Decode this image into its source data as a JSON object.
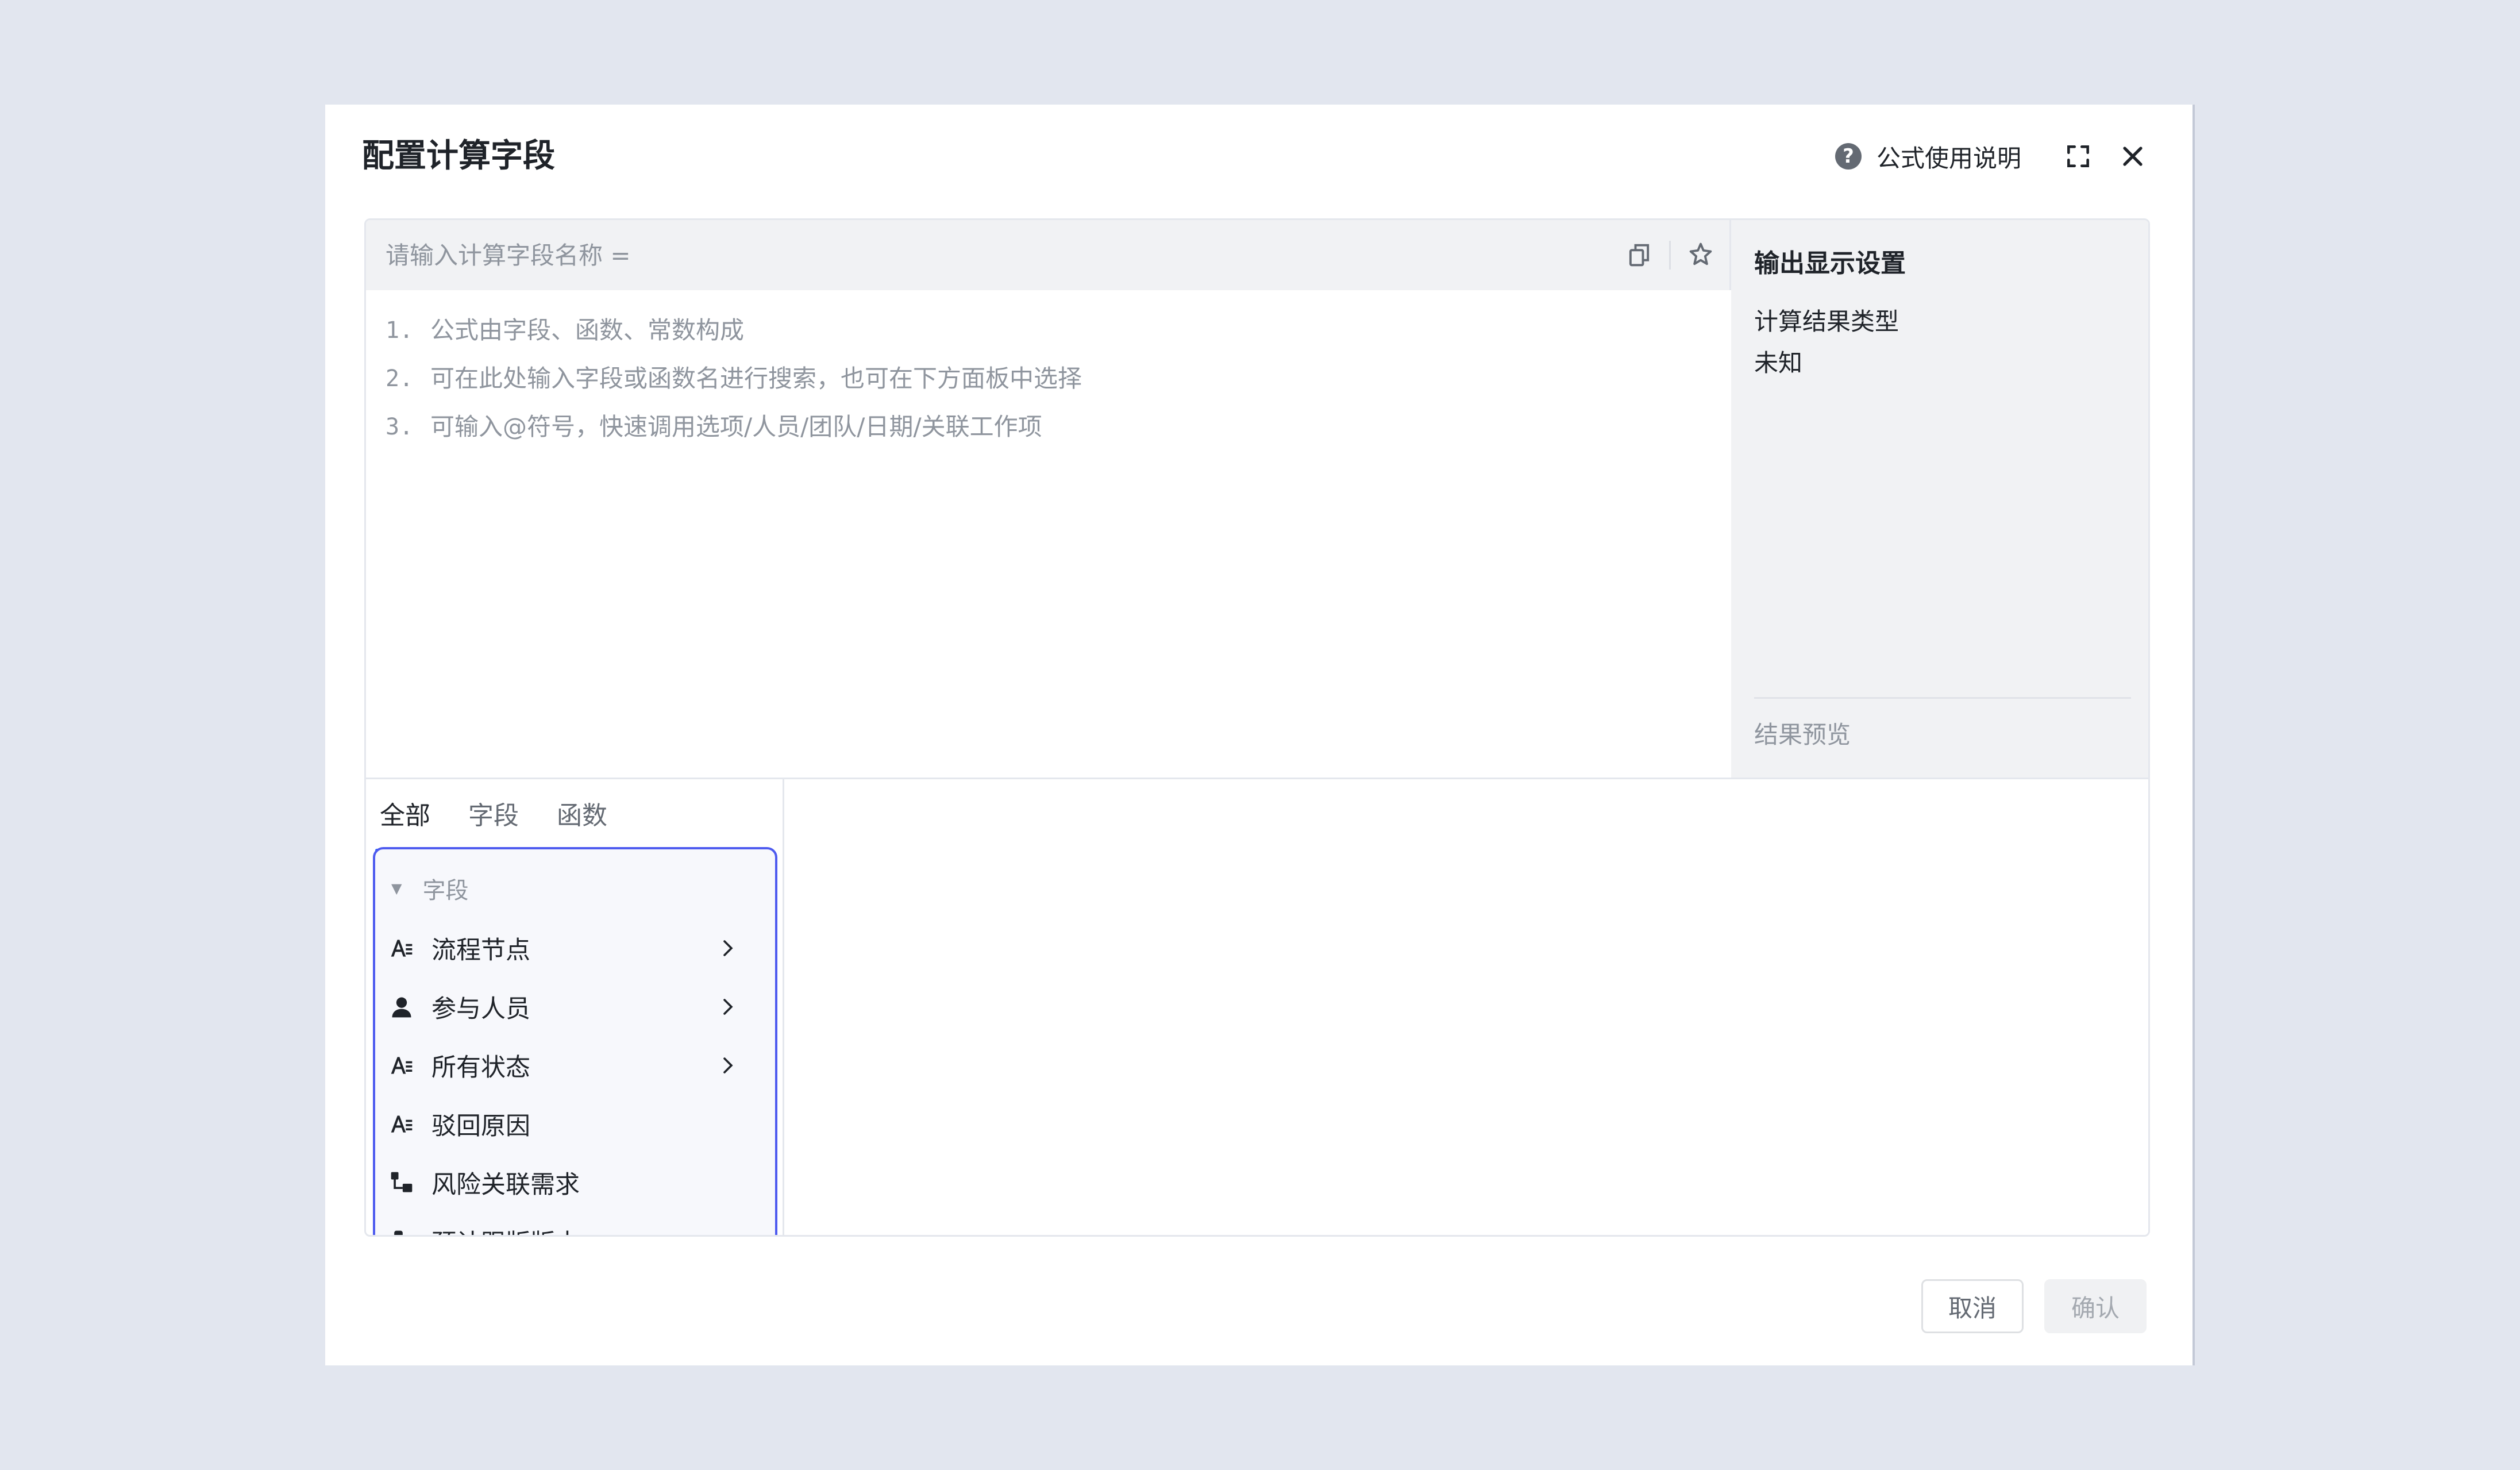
{
  "dialog": {
    "title": "配置计算字段",
    "help_label": "公式使用说明",
    "help_icon": "?",
    "icons": {
      "help": "question-circle-icon",
      "expand": "expand-icon",
      "close": "close-icon"
    }
  },
  "editor": {
    "name_placeholder": "请输入计算字段名称 =",
    "hints": [
      {
        "num": "1.",
        "text": "公式由字段、函数、常数构成"
      },
      {
        "num": "2.",
        "text": "可在此处输入字段或函数名进行搜索，也可在下方面板中选择"
      },
      {
        "num": "3.",
        "text": "可输入@符号，快速调用选项/人员/团队/日期/关联工作项"
      }
    ]
  },
  "output": {
    "title": "输出显示设置",
    "result_type_label": "计算结果类型",
    "result_type_value": "未知",
    "preview_label": "结果预览"
  },
  "tabs": [
    {
      "label": "全部",
      "active": true
    },
    {
      "label": "字段",
      "active": false
    },
    {
      "label": "函数",
      "active": false
    }
  ],
  "field_list": {
    "group_label": "字段",
    "items": [
      {
        "label": "流程节点",
        "icon": "text-field-icon",
        "has_children": true
      },
      {
        "label": "参与人员",
        "icon": "person-icon",
        "has_children": true
      },
      {
        "label": "所有状态",
        "icon": "text-field-icon",
        "has_children": true
      },
      {
        "label": "驳回原因",
        "icon": "text-field-icon",
        "has_children": false
      },
      {
        "label": "风险关联需求",
        "icon": "link-item-icon",
        "has_children": false
      },
      {
        "label": "预计跟版版本",
        "icon": "pin-icon",
        "has_children": false
      }
    ]
  },
  "footer": {
    "cancel_label": "取消",
    "confirm_label": "确认"
  },
  "colors": {
    "accent": "#3370ff",
    "list_border": "#4e5bef",
    "text_primary": "#1f2329",
    "text_secondary": "#8f959e",
    "panel_bg": "#f1f2f4"
  }
}
